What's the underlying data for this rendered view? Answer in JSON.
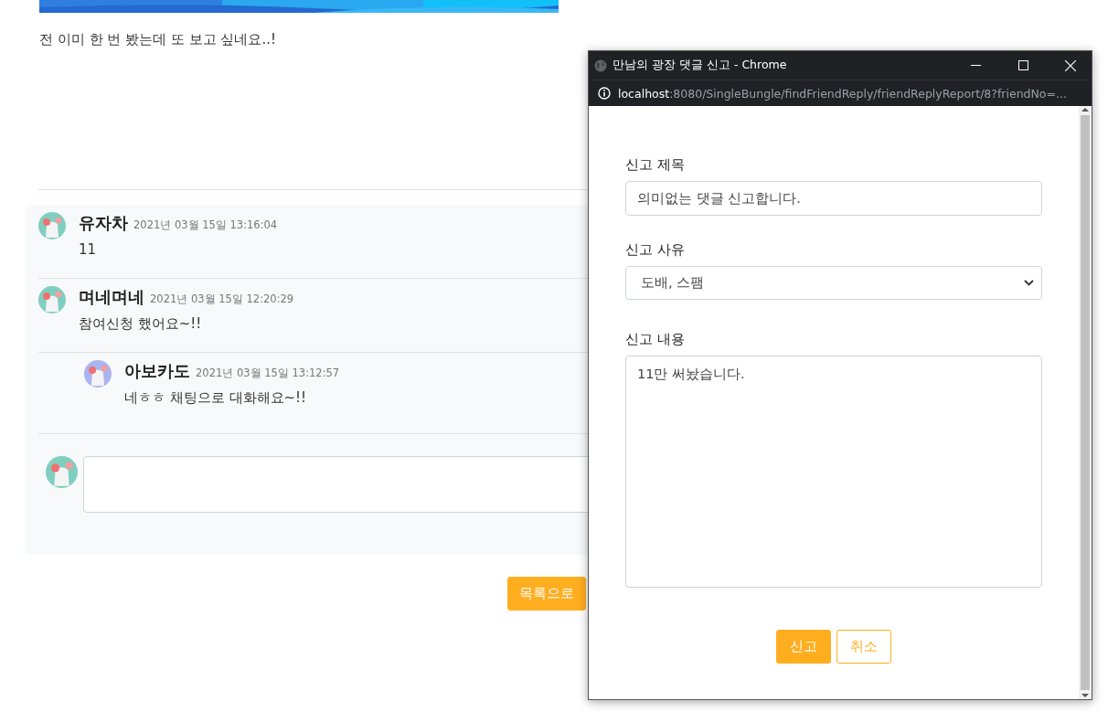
{
  "page": {
    "post_text": "전 이미 한 번 봤는데 또 보고 싶네요..!",
    "comments": [
      {
        "author": "유자차",
        "date": "2021년 03월 15일 13:16:04",
        "text": "11",
        "color": "#7fcfc0"
      },
      {
        "author": "며네며네",
        "date": "2021년 03월 15일 12:20:29",
        "text": "참여신청 했어요~!!",
        "color": "#7fcfc0",
        "children": [
          {
            "author": "아보카도",
            "date": "2021년 03월 15일 13:12:57",
            "text": "네ㅎㅎ 채팅으로 대화해요~!!",
            "color": "#a9b4f0"
          }
        ]
      }
    ],
    "list_button": "목록으로"
  },
  "popup": {
    "title": "만남의 광장 댓글 신고 - Chrome",
    "url_host": "localhost",
    "url_rest": ":8080/SingleBungle/findFriendReply/friendReplyReport/8?friendNo=...",
    "fields": [
      {
        "kind": "input",
        "label": "신고 제목",
        "value": "의미없는 댓글 신고합니다."
      },
      {
        "kind": "select",
        "label": "신고 사유",
        "value": "도배, 스팸"
      },
      {
        "kind": "textarea",
        "label": "신고 내용",
        "value": "11만 써놨습니다."
      }
    ],
    "buttons": [
      {
        "kind": "primary",
        "label": "신고"
      },
      {
        "kind": "outline",
        "label": "취소"
      }
    ]
  }
}
